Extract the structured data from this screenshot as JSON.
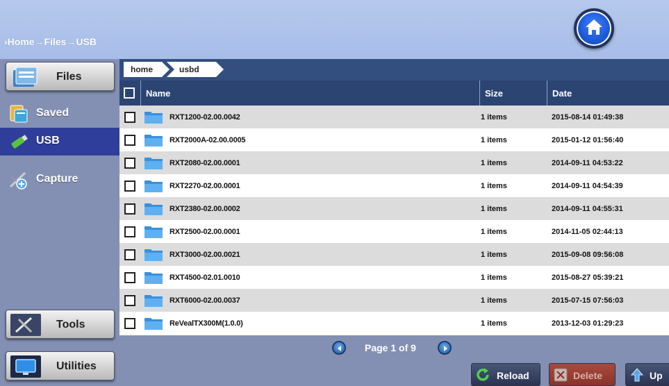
{
  "header": {
    "breadcrumb": "›Home→Files→USB",
    "home_icon": "home-icon"
  },
  "sidebar": {
    "files_label": "Files",
    "items": [
      {
        "label": "Saved",
        "icon": "saved-icon"
      },
      {
        "label": "USB",
        "icon": "usb-icon",
        "active": true
      },
      {
        "label": "Capture",
        "icon": "capture-icon"
      }
    ],
    "tools_label": "Tools",
    "utilities_label": "Utilities"
  },
  "pathbar": {
    "crumbs": [
      "home",
      "usbd"
    ]
  },
  "table": {
    "columns": [
      "Name",
      "Size",
      "Date"
    ],
    "rows": [
      {
        "name": "RXT1200-02.00.0042",
        "size": "1 items",
        "date": "2015-08-14 01:49:38"
      },
      {
        "name": "RXT2000A-02.00.0005",
        "size": "1 items",
        "date": "2015-01-12 01:56:40"
      },
      {
        "name": "RXT2080-02.00.0001",
        "size": "1 items",
        "date": "2014-09-11 04:53:22"
      },
      {
        "name": "RXT2270-02.00.0001",
        "size": "1 items",
        "date": "2014-09-11 04:54:39"
      },
      {
        "name": "RXT2380-02.00.0002",
        "size": "1 items",
        "date": "2014-09-11 04:55:31"
      },
      {
        "name": "RXT2500-02.00.0001",
        "size": "1 items",
        "date": "2014-11-05 02:44:13"
      },
      {
        "name": "RXT3000-02.00.0021",
        "size": "1 items",
        "date": "2015-09-08 09:56:08"
      },
      {
        "name": "RXT4500-02.01.0010",
        "size": "1 items",
        "date": "2015-08-27 05:39:21"
      },
      {
        "name": "RXT6000-02.00.0037",
        "size": "1 items",
        "date": "2015-07-15 07:56:03"
      },
      {
        "name": "ReVealTX300M(1.0.0)",
        "size": "1 items",
        "date": "2013-12-03 01:29:23"
      }
    ]
  },
  "pager": {
    "label": "Page 1 of 9"
  },
  "actions": {
    "reload_label": "Reload",
    "delete_label": "Delete",
    "up_label": "Up"
  },
  "colors": {
    "header_bg": "#b6c8ec",
    "sidebar_bg": "#8390b3",
    "table_header_bg": "#2c4472",
    "active_item_bg": "#2f3e9a"
  }
}
